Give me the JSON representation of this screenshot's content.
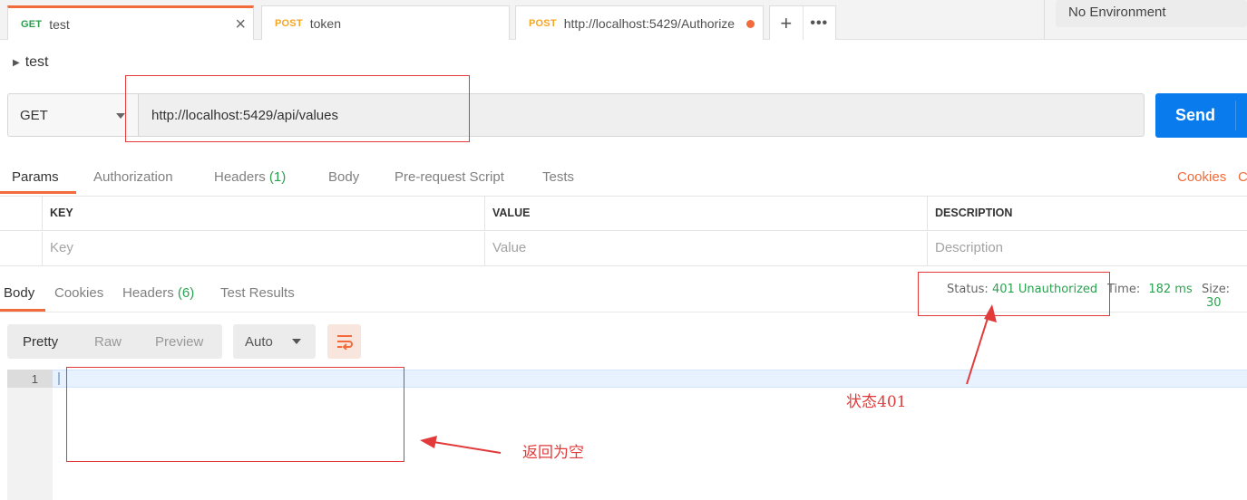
{
  "tabs": [
    {
      "method": "GET",
      "label": "test"
    },
    {
      "method": "POST",
      "label": "token"
    },
    {
      "method": "POST",
      "label": "http://localhost:5429/Authorize"
    }
  ],
  "tab_actions": {
    "new": "+",
    "more": "•••"
  },
  "environment": "No Environment",
  "request": {
    "name": "test",
    "method": "GET",
    "url": "http://localhost:5429/api/values",
    "send_label": "Send"
  },
  "request_tabs": {
    "params": "Params",
    "authorization": "Authorization",
    "headers": "Headers",
    "headers_count": "(1)",
    "body": "Body",
    "prerequest": "Pre-request Script",
    "tests": "Tests",
    "cookies": "Cookies",
    "code": "C"
  },
  "params_table": {
    "columns": [
      "KEY",
      "VALUE",
      "DESCRIPTION"
    ],
    "placeholders": [
      "Key",
      "Value",
      "Description"
    ]
  },
  "response_tabs": {
    "body": "Body",
    "cookies": "Cookies",
    "headers": "Headers",
    "headers_count": "(6)",
    "test_results": "Test Results"
  },
  "response_meta": {
    "status_label": "Status:",
    "status_value": "401 Unauthorized",
    "time_label": "Time:",
    "time_value": "182 ms",
    "size_label": "Size:",
    "size_value": "30"
  },
  "view_controls": {
    "pretty": "Pretty",
    "raw": "Raw",
    "preview": "Preview",
    "format": "Auto"
  },
  "editor": {
    "line_number": "1"
  },
  "annotations": {
    "status_note": "状态401",
    "body_note": "返回为空",
    "color": "#e23a3a"
  },
  "colors": {
    "accent": "#f26b3a",
    "send": "#097bed",
    "success": "#2aa150",
    "get": "#2a9d4d",
    "post": "#f5a623"
  }
}
